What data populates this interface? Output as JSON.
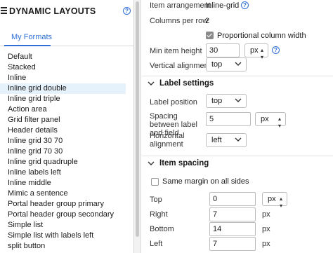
{
  "left_panel": {
    "title": "DYNAMIC LAYOUTS",
    "help_icon": "question-circle-icon",
    "tab_label": "My Formats",
    "formats": [
      "Default",
      "Stacked",
      "Inline",
      "Inline grid double",
      "Inline grid triple",
      "Action area",
      "Grid filter panel",
      "Header details",
      "Inline grid 30 70",
      "Inline grid 70 30",
      "Inline grid quadruple",
      "Inline labels left",
      "Inline middle",
      "Mimic a sentence",
      "Portal header group primary",
      "Portal header group secondary",
      "Simple list",
      "Simple list with labels left",
      "split button"
    ],
    "selected_format": "Inline grid double"
  },
  "right_panel": {
    "item_arrangement_label": "Item arrangement",
    "item_arrangement_value": "Inline-grid",
    "columns_per_row_label": "Columns per row",
    "columns_per_row_value": "2",
    "proportional_label": "Proportional column width",
    "proportional_checked": true,
    "min_item_height_label": "Min item height",
    "min_item_height_value": "30",
    "min_item_height_unit": "px",
    "vertical_alignment_label": "Vertical alignment",
    "vertical_alignment_value": "top",
    "label_settings": {
      "title": "Label settings",
      "label_position_label": "Label position",
      "label_position_value": "top",
      "spacing_label": "Spacing between label and field",
      "spacing_value": "5",
      "spacing_unit": "px",
      "horizontal_alignment_label": "Horizontal alignment",
      "horizontal_alignment_value": "left"
    },
    "item_spacing": {
      "title": "Item spacing",
      "same_margin_label": "Same margin on all sides",
      "same_margin_checked": false,
      "top_label": "Top",
      "top_value": "0",
      "top_unit": "px",
      "right_label": "Right",
      "right_value": "7",
      "right_unit": "px",
      "bottom_label": "Bottom",
      "bottom_value": "14",
      "bottom_unit": "px",
      "left_label": "Left",
      "left_value": "7",
      "left_unit": "px"
    }
  },
  "colors": {
    "accent": "#2f6fd6",
    "selected_row": "#e6f2fb",
    "checkbox_checked": "#8a8a8a"
  }
}
